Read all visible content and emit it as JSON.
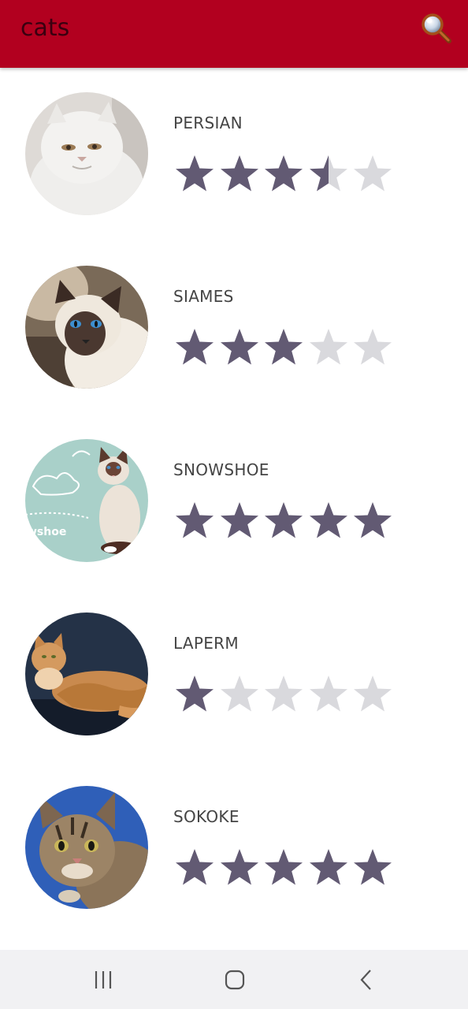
{
  "app": {
    "title": "cats",
    "accent_color": "#b2001f",
    "search_icon": "magnifier-icon"
  },
  "cats": [
    {
      "name": "PERSIAN",
      "rating": 3.5,
      "max_rating": 5,
      "image": "white-persian-cat"
    },
    {
      "name": "SIAMES",
      "rating": 3,
      "max_rating": 5,
      "image": "siamese-cat"
    },
    {
      "name": "SNOWSHOE",
      "rating": 5,
      "max_rating": 5,
      "image": "snowshoe-cat",
      "image_caption": "wshoe"
    },
    {
      "name": "LAPERM",
      "rating": 1,
      "max_rating": 5,
      "image": "laperm-cat"
    },
    {
      "name": "SOKOKE",
      "rating": 5,
      "max_rating": 5,
      "image": "sokoke-cat"
    }
  ],
  "colors": {
    "star_filled": "#625a73",
    "star_empty": "#d9d9dd"
  },
  "navbar": {
    "recents_icon": "recents-icon",
    "home_icon": "home-icon",
    "back_icon": "back-icon"
  }
}
